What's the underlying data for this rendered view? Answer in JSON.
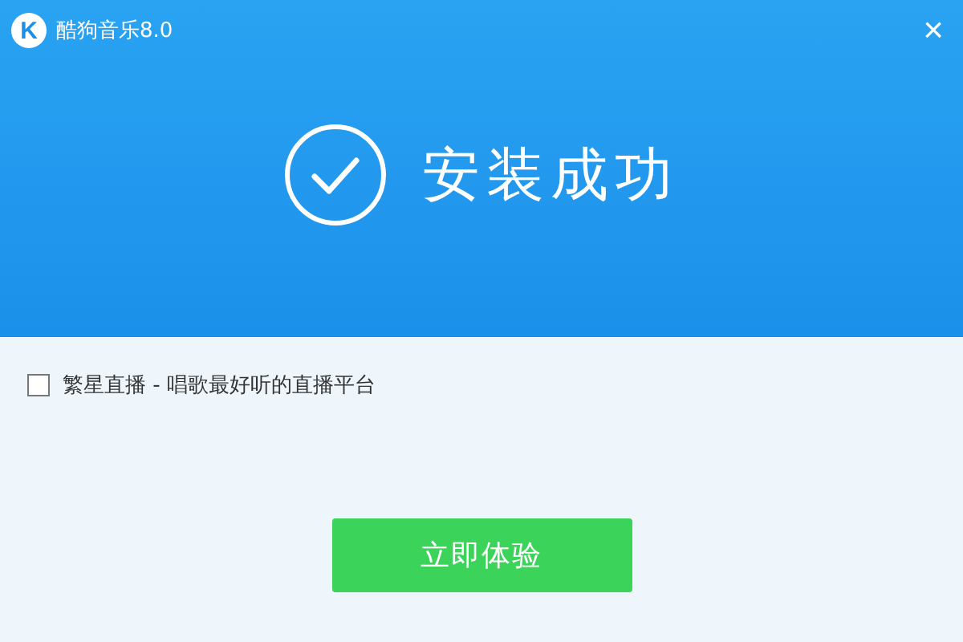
{
  "window": {
    "logo": "K",
    "title": "酷狗音乐8.0",
    "close": "×"
  },
  "status": {
    "text": "安装成功"
  },
  "option": {
    "label": "繁星直播 - 唱歌最好听的直播平台",
    "checked": false
  },
  "button": {
    "label": "立即体验"
  }
}
